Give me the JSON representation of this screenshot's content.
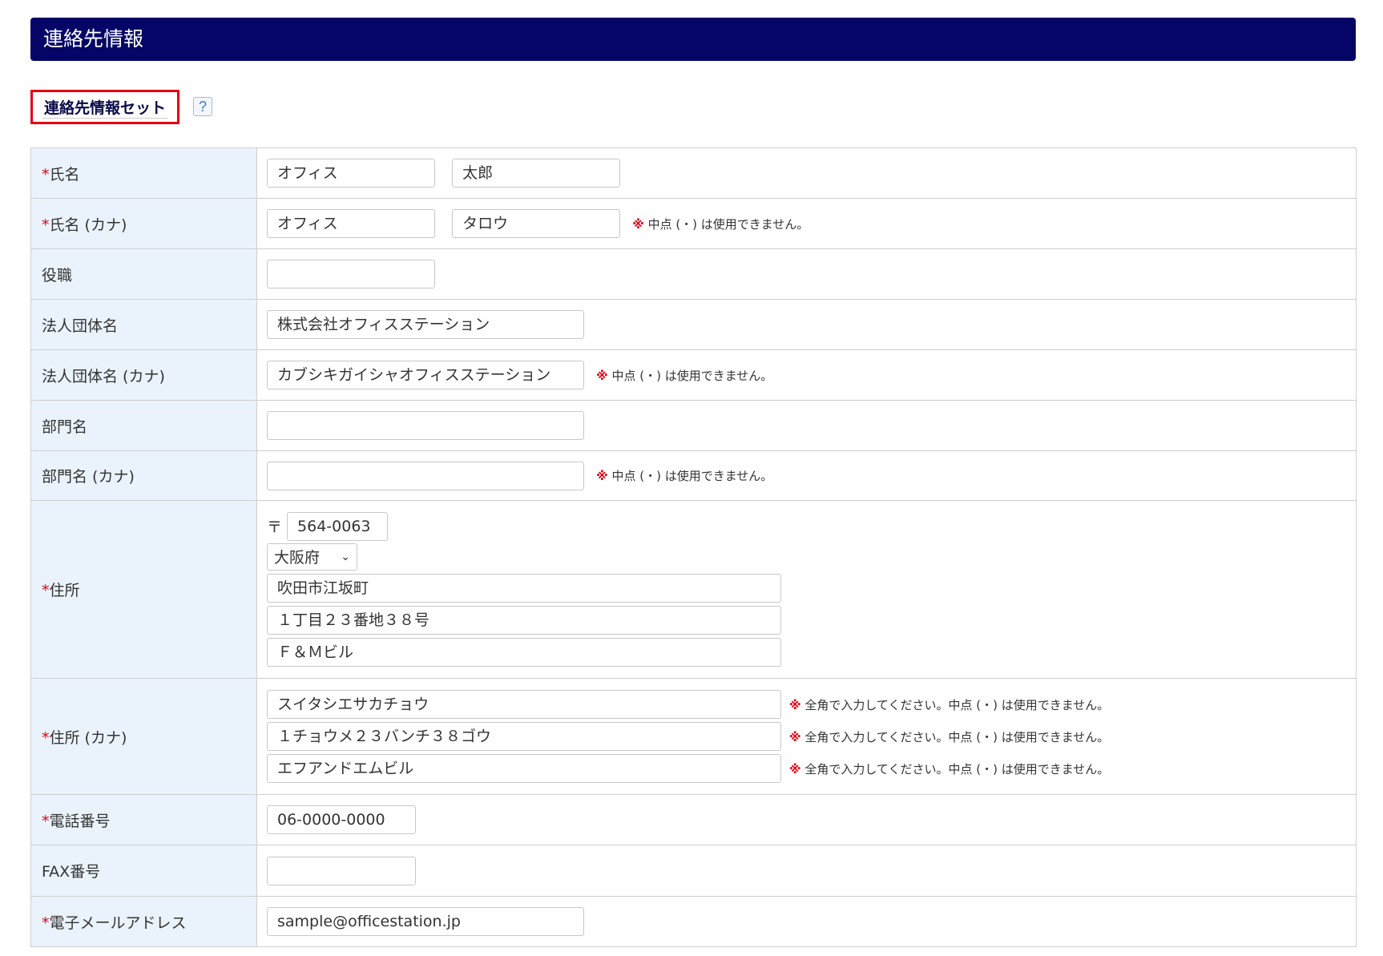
{
  "header": {
    "title": "連絡先情報"
  },
  "set_button": {
    "label": "連絡先情報セット"
  },
  "help": {
    "label": "?"
  },
  "required_mark": "*",
  "note_mark": "※",
  "fields": {
    "name": {
      "label": "氏名",
      "last": "オフィス",
      "first": "太郎"
    },
    "name_kana": {
      "label": "氏名 (カナ)",
      "last": "オフィス",
      "first": "タロウ",
      "note": "中点 (・) は使用できません。"
    },
    "title": {
      "label": "役職",
      "value": ""
    },
    "company": {
      "label": "法人団体名",
      "value": "株式会社オフィスステーション"
    },
    "company_kana": {
      "label": "法人団体名 (カナ)",
      "value": "カブシキガイシャオフィスステーション",
      "note": "中点 (・) は使用できません。"
    },
    "dept": {
      "label": "部門名",
      "value": ""
    },
    "dept_kana": {
      "label": "部門名 (カナ)",
      "value": "",
      "note": "中点 (・) は使用できません。"
    },
    "address": {
      "label": "住所",
      "zip_mark": "〒",
      "zip": "564-0063",
      "prefecture": "大阪府",
      "line1": "吹田市江坂町",
      "line2": "１丁目２３番地３８号",
      "line3": "Ｆ＆Ｍビル"
    },
    "address_kana": {
      "label": "住所 (カナ)",
      "line1": "スイタシエサカチョウ",
      "line2": "１チョウメ２３バンチ３８ゴウ",
      "line3": "エフアンドエムビル",
      "note": "全角で入力してください。中点 (・) は使用できません。"
    },
    "phone": {
      "label": "電話番号",
      "value": "06-0000-0000"
    },
    "fax": {
      "label": "FAX番号",
      "value": ""
    },
    "email": {
      "label": "電子メールアドレス",
      "value": "sample@officestation.jp"
    }
  }
}
